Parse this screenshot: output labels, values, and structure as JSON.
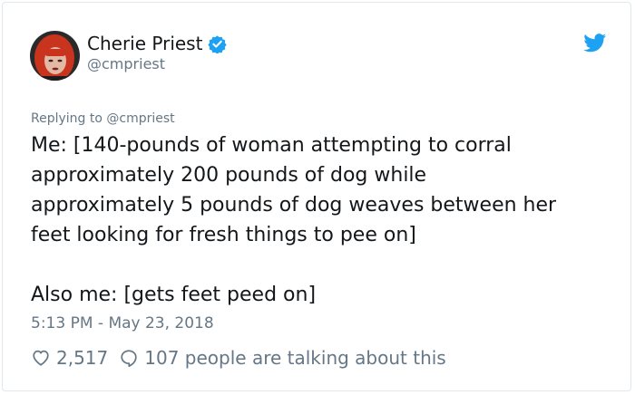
{
  "user": {
    "display_name": "Cherie Priest",
    "handle": "@cmpriest",
    "verified": true
  },
  "reply_context": {
    "prefix": "Replying to ",
    "mention": "@cmpriest"
  },
  "tweet": {
    "lines": [
      "Me: [140-pounds of woman attempting to corral",
      "approximately 200 pounds of dog while",
      "approximately 5 pounds of dog weaves between her",
      "feet looking for fresh things to pee on]",
      "Also me: [gets feet peed on]"
    ]
  },
  "timestamp": "5:13 PM - May 23, 2018",
  "actions": {
    "likes_count": "2,517",
    "replies_text": "107 people are talking about this"
  },
  "icons": {
    "verified": "verified-badge-icon",
    "brand": "twitter-bird-icon",
    "like": "heart-icon",
    "reply": "speech-bubble-icon"
  },
  "colors": {
    "brand_blue": "#1da1f2",
    "secondary_text": "#657786",
    "primary_text": "#14171a"
  }
}
